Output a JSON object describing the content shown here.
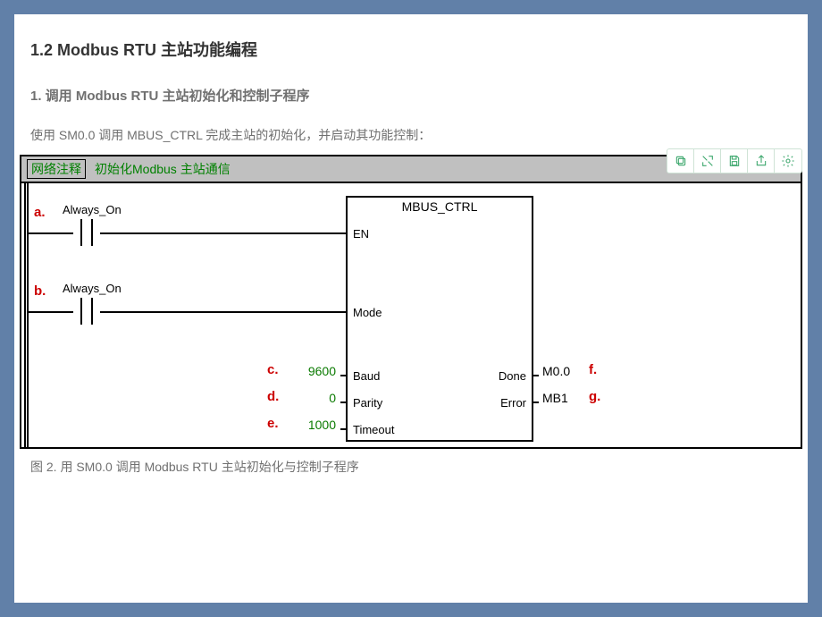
{
  "section_title": "1.2 Modbus RTU 主站功能编程",
  "step_title": "1. 调用 Modbus RTU 主站初始化和控制子程序",
  "intro": "使用 SM0.0 调用 MBUS_CTRL 完成主站的初始化，并启动其功能控制：",
  "network": {
    "comment_label": "网络注释",
    "comment_text": "初始化Modbus 主站通信"
  },
  "ladder": {
    "rung_a": {
      "marker": "a.",
      "contact_label": "Always_On"
    },
    "rung_b": {
      "marker": "b.",
      "contact_label": "Always_On"
    },
    "block": {
      "title": "MBUS_CTRL",
      "inputs": {
        "en": {
          "label": "EN"
        },
        "mode": {
          "label": "Mode"
        },
        "baud": {
          "label": "Baud",
          "marker": "c.",
          "value": "9600"
        },
        "parity": {
          "label": "Parity",
          "marker": "d.",
          "value": "0"
        },
        "timeout": {
          "label": "Timeout",
          "marker": "e.",
          "value": "1000"
        }
      },
      "outputs": {
        "done": {
          "label": "Done",
          "marker": "f.",
          "value": "M0.0"
        },
        "error": {
          "label": "Error",
          "marker": "g.",
          "value": "MB1"
        }
      }
    }
  },
  "caption": "图 2. 用 SM0.0 调用 Modbus RTU 主站初始化与控制子程序"
}
